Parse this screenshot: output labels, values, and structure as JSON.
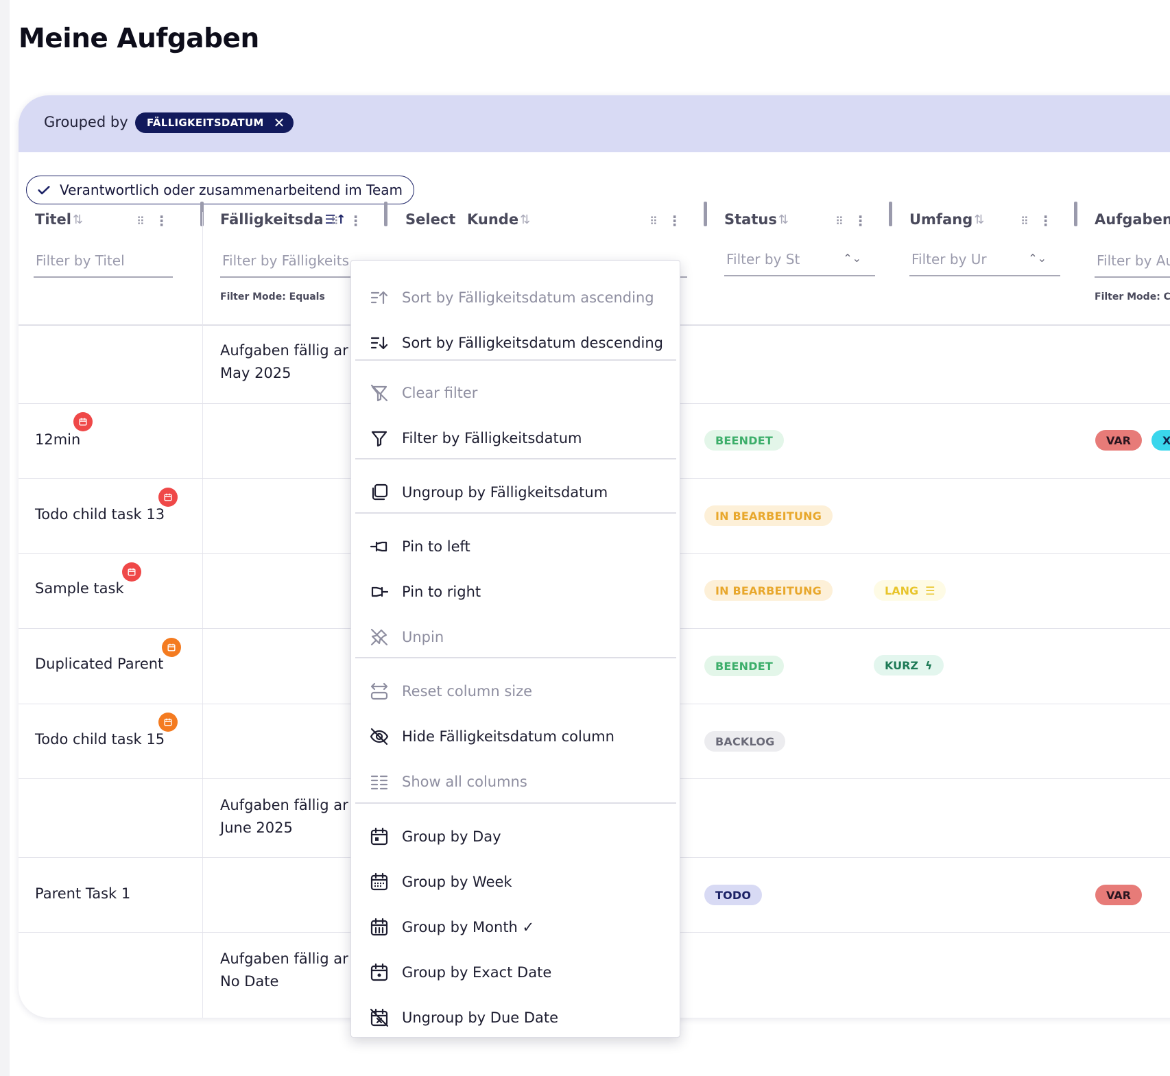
{
  "page": {
    "title": "Meine Aufgaben"
  },
  "grouping": {
    "label": "Grouped by",
    "chip": "FÄLLIGKEITSDATUM"
  },
  "team_filter": {
    "label": "Verantwortlich oder zusammenarbeitend im Team"
  },
  "columns": {
    "titel": {
      "title": "Titel",
      "filter_placeholder": "Filter by Titel"
    },
    "faellig": {
      "title": "Fälligkeitsda",
      "filter_placeholder": "Filter by Fälligkeits",
      "filter_mode": "Filter Mode: Equals"
    },
    "select": {
      "title": "Select"
    },
    "kunde": {
      "title": "Kunde"
    },
    "status": {
      "title": "Status",
      "filter_placeholder": "Filter by St"
    },
    "umfang": {
      "title": "Umfang",
      "filter_placeholder": "Filter by Ur"
    },
    "aufgabentyp": {
      "title": "Aufgabent",
      "filter_placeholder": "Filter by Au",
      "filter_mode": "Filter Mode: Co"
    }
  },
  "groups": [
    {
      "line1": "Aufgaben fällig ar",
      "line2": "May 2025"
    },
    {
      "line1": "Aufgaben fällig ar",
      "line2": "June 2025"
    },
    {
      "line1": "Aufgaben fällig ar",
      "line2": "No Date"
    }
  ],
  "rows": [
    {
      "title": "12min",
      "status": "BEENDET",
      "tags": [
        "VAR",
        "X"
      ]
    },
    {
      "title": "Todo child task 13",
      "status": "IN BEARBEITUNG"
    },
    {
      "title": "Sample task",
      "status": "IN BEARBEITUNG",
      "umfang": "LANG"
    },
    {
      "title": "Duplicated Parent",
      "status": "BEENDET",
      "umfang": "KURZ"
    },
    {
      "title": "Todo child task 15",
      "status": "BACKLOG"
    },
    {
      "title": "Parent Task 1",
      "status": "TODO",
      "tags": [
        "VAR"
      ]
    }
  ],
  "menu": {
    "items": [
      {
        "label": "Sort by Fälligkeitsdatum ascending",
        "icon": "sort-ascending-icon",
        "enabled": false
      },
      {
        "label": "Sort by Fälligkeitsdatum descending",
        "icon": "sort-descending-icon",
        "enabled": true
      },
      {
        "label": "Clear filter",
        "icon": "clear-filter-icon",
        "enabled": false
      },
      {
        "label": "Filter by Fälligkeitsdatum",
        "icon": "filter-icon",
        "enabled": true
      },
      {
        "label": "Ungroup by Fälligkeitsdatum",
        "icon": "ungroup-icon",
        "enabled": true
      },
      {
        "label": "Pin to left",
        "icon": "pin-left-icon",
        "enabled": true
      },
      {
        "label": "Pin to right",
        "icon": "pin-right-icon",
        "enabled": true
      },
      {
        "label": "Unpin",
        "icon": "unpin-icon",
        "enabled": false
      },
      {
        "label": "Reset column size",
        "icon": "reset-size-icon",
        "enabled": false
      },
      {
        "label": "Hide Fälligkeitsdatum column",
        "icon": "eye-off-icon",
        "enabled": true
      },
      {
        "label": "Show all columns",
        "icon": "columns-icon",
        "enabled": false
      },
      {
        "label": "Group by Day",
        "icon": "calendar-day-icon",
        "enabled": true
      },
      {
        "label": "Group by Week",
        "icon": "calendar-week-icon",
        "enabled": true
      },
      {
        "label": "Group by Month ✓",
        "icon": "calendar-month-icon",
        "enabled": true
      },
      {
        "label": "Group by Exact Date",
        "icon": "calendar-exact-icon",
        "enabled": true
      },
      {
        "label": "Ungroup by Due Date",
        "icon": "calendar-off-icon",
        "enabled": true
      }
    ]
  },
  "colors": {
    "accent": "#121a5c",
    "group_bar": "#d8daf4",
    "badge_red": "#ef4848",
    "badge_orange": "#f47b20"
  }
}
